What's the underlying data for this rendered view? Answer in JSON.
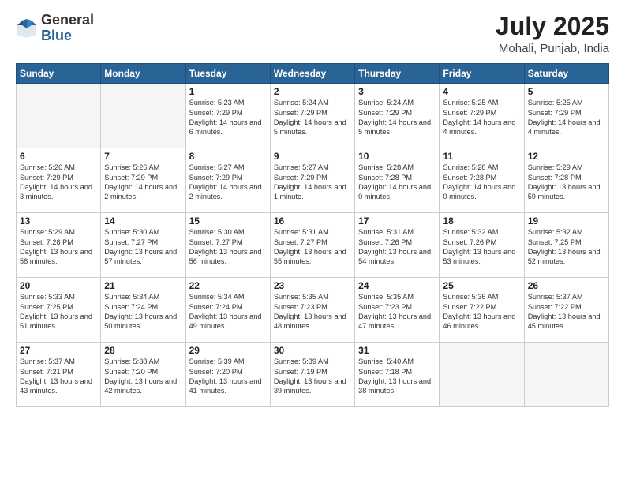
{
  "header": {
    "logo_general": "General",
    "logo_blue": "Blue",
    "month": "July 2025",
    "location": "Mohali, Punjab, India"
  },
  "weekdays": [
    "Sunday",
    "Monday",
    "Tuesday",
    "Wednesday",
    "Thursday",
    "Friday",
    "Saturday"
  ],
  "weeks": [
    [
      {
        "day": "",
        "info": ""
      },
      {
        "day": "",
        "info": ""
      },
      {
        "day": "1",
        "info": "Sunrise: 5:23 AM\nSunset: 7:29 PM\nDaylight: 14 hours and 6 minutes."
      },
      {
        "day": "2",
        "info": "Sunrise: 5:24 AM\nSunset: 7:29 PM\nDaylight: 14 hours and 5 minutes."
      },
      {
        "day": "3",
        "info": "Sunrise: 5:24 AM\nSunset: 7:29 PM\nDaylight: 14 hours and 5 minutes."
      },
      {
        "day": "4",
        "info": "Sunrise: 5:25 AM\nSunset: 7:29 PM\nDaylight: 14 hours and 4 minutes."
      },
      {
        "day": "5",
        "info": "Sunrise: 5:25 AM\nSunset: 7:29 PM\nDaylight: 14 hours and 4 minutes."
      }
    ],
    [
      {
        "day": "6",
        "info": "Sunrise: 5:26 AM\nSunset: 7:29 PM\nDaylight: 14 hours and 3 minutes."
      },
      {
        "day": "7",
        "info": "Sunrise: 5:26 AM\nSunset: 7:29 PM\nDaylight: 14 hours and 2 minutes."
      },
      {
        "day": "8",
        "info": "Sunrise: 5:27 AM\nSunset: 7:29 PM\nDaylight: 14 hours and 2 minutes."
      },
      {
        "day": "9",
        "info": "Sunrise: 5:27 AM\nSunset: 7:29 PM\nDaylight: 14 hours and 1 minute."
      },
      {
        "day": "10",
        "info": "Sunrise: 5:28 AM\nSunset: 7:28 PM\nDaylight: 14 hours and 0 minutes."
      },
      {
        "day": "11",
        "info": "Sunrise: 5:28 AM\nSunset: 7:28 PM\nDaylight: 14 hours and 0 minutes."
      },
      {
        "day": "12",
        "info": "Sunrise: 5:29 AM\nSunset: 7:28 PM\nDaylight: 13 hours and 59 minutes."
      }
    ],
    [
      {
        "day": "13",
        "info": "Sunrise: 5:29 AM\nSunset: 7:28 PM\nDaylight: 13 hours and 58 minutes."
      },
      {
        "day": "14",
        "info": "Sunrise: 5:30 AM\nSunset: 7:27 PM\nDaylight: 13 hours and 57 minutes."
      },
      {
        "day": "15",
        "info": "Sunrise: 5:30 AM\nSunset: 7:27 PM\nDaylight: 13 hours and 56 minutes."
      },
      {
        "day": "16",
        "info": "Sunrise: 5:31 AM\nSunset: 7:27 PM\nDaylight: 13 hours and 55 minutes."
      },
      {
        "day": "17",
        "info": "Sunrise: 5:31 AM\nSunset: 7:26 PM\nDaylight: 13 hours and 54 minutes."
      },
      {
        "day": "18",
        "info": "Sunrise: 5:32 AM\nSunset: 7:26 PM\nDaylight: 13 hours and 53 minutes."
      },
      {
        "day": "19",
        "info": "Sunrise: 5:32 AM\nSunset: 7:25 PM\nDaylight: 13 hours and 52 minutes."
      }
    ],
    [
      {
        "day": "20",
        "info": "Sunrise: 5:33 AM\nSunset: 7:25 PM\nDaylight: 13 hours and 51 minutes."
      },
      {
        "day": "21",
        "info": "Sunrise: 5:34 AM\nSunset: 7:24 PM\nDaylight: 13 hours and 50 minutes."
      },
      {
        "day": "22",
        "info": "Sunrise: 5:34 AM\nSunset: 7:24 PM\nDaylight: 13 hours and 49 minutes."
      },
      {
        "day": "23",
        "info": "Sunrise: 5:35 AM\nSunset: 7:23 PM\nDaylight: 13 hours and 48 minutes."
      },
      {
        "day": "24",
        "info": "Sunrise: 5:35 AM\nSunset: 7:23 PM\nDaylight: 13 hours and 47 minutes."
      },
      {
        "day": "25",
        "info": "Sunrise: 5:36 AM\nSunset: 7:22 PM\nDaylight: 13 hours and 46 minutes."
      },
      {
        "day": "26",
        "info": "Sunrise: 5:37 AM\nSunset: 7:22 PM\nDaylight: 13 hours and 45 minutes."
      }
    ],
    [
      {
        "day": "27",
        "info": "Sunrise: 5:37 AM\nSunset: 7:21 PM\nDaylight: 13 hours and 43 minutes."
      },
      {
        "day": "28",
        "info": "Sunrise: 5:38 AM\nSunset: 7:20 PM\nDaylight: 13 hours and 42 minutes."
      },
      {
        "day": "29",
        "info": "Sunrise: 5:39 AM\nSunset: 7:20 PM\nDaylight: 13 hours and 41 minutes."
      },
      {
        "day": "30",
        "info": "Sunrise: 5:39 AM\nSunset: 7:19 PM\nDaylight: 13 hours and 39 minutes."
      },
      {
        "day": "31",
        "info": "Sunrise: 5:40 AM\nSunset: 7:18 PM\nDaylight: 13 hours and 38 minutes."
      },
      {
        "day": "",
        "info": ""
      },
      {
        "day": "",
        "info": ""
      }
    ]
  ]
}
